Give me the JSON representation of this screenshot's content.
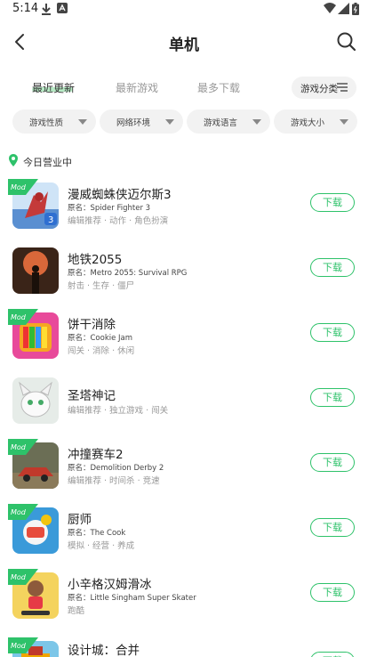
{
  "status_bar": {
    "time": "5:14"
  },
  "header": {
    "title": "单机"
  },
  "tabs": [
    {
      "label": "最近更新",
      "active": true
    },
    {
      "label": "最新游戏",
      "active": false
    },
    {
      "label": "最多下载",
      "active": false
    }
  ],
  "category_button": {
    "label": "游戏分类"
  },
  "filters": [
    "游戏性质",
    "网络环境",
    "游戏语言",
    "游戏大小"
  ],
  "section": {
    "label": "今日营业中"
  },
  "games": [
    {
      "name": "漫威蜘蛛侠迈尔斯3",
      "original": "原名：Spider Fighter 3",
      "tags": "编辑推荐 · 动作 · 角色扮演",
      "mod": true,
      "download": "下载"
    },
    {
      "name": "地铁2055",
      "original": "原名：Metro 2055: Survival RPG",
      "tags": "射击 · 生存 · 僵尸",
      "mod": false,
      "download": "下载"
    },
    {
      "name": "饼干消除",
      "original": "原名：Cookie Jam",
      "tags": "闯关 · 消除 · 休闲",
      "mod": true,
      "download": "下载"
    },
    {
      "name": "圣塔神记",
      "original": "",
      "tags": "编辑推荐 · 独立游戏 · 闯关",
      "mod": false,
      "download": "下载"
    },
    {
      "name": "冲撞赛车2",
      "original": "原名：Demolition Derby 2",
      "tags": "编辑推荐 · 时间杀 · 竞速",
      "mod": true,
      "download": "下载"
    },
    {
      "name": "厨师",
      "original": "原名：The Cook",
      "tags": "模拟 · 经营 · 养成",
      "mod": true,
      "download": "下载"
    },
    {
      "name": "小辛格汉姆滑冰",
      "original": "原名：Little Singham Super Skater",
      "tags": "跑酷",
      "mod": true,
      "download": "下载"
    },
    {
      "name": "设计城：合并",
      "original": "",
      "tags": "",
      "mod": true,
      "download": "下载"
    }
  ],
  "mod_badge": "Mod",
  "colors": {
    "accent": "#2ec26a",
    "section_icon": "#2ec26a"
  }
}
